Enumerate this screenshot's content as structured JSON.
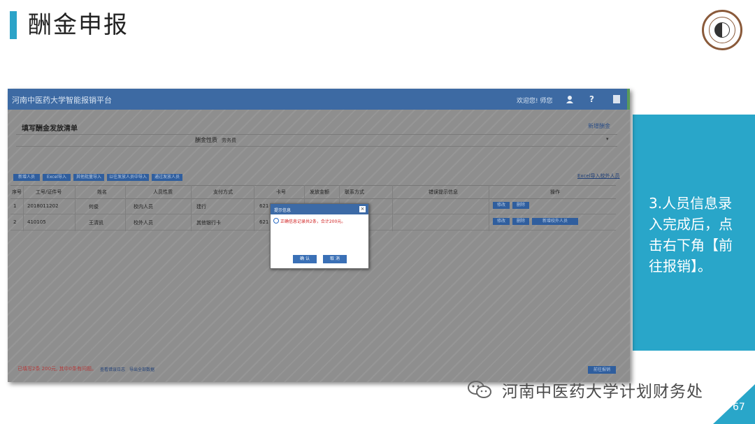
{
  "slide": {
    "title": "酬金申报",
    "side_instruction": "3.人员信息录入完成后，点击右下角【前往报销】。",
    "org_name": "河南中医药大学计划财务处",
    "page_number": "67",
    "accent_color": "#2ba3c8"
  },
  "app": {
    "title": "河南中医药大学智能报销平台",
    "welcome": "欢迎您! 师您",
    "icons": [
      "user-icon",
      "help-icon",
      "document-icon"
    ]
  },
  "form": {
    "title": "填写酬金发放清单",
    "new_link": "新增酬金",
    "property_label": "酬金性质",
    "property_value": "劳务费",
    "toolbar_buttons": [
      "新增人员",
      "Excel导入",
      "其他批量导入",
      "以往发放人员中导入",
      "通过发放人员"
    ],
    "import_link": "Excel导入校外人员",
    "columns": [
      "序号",
      "工号/证件号",
      "姓名",
      "人员性质",
      "支付方式",
      "卡号",
      "发放金额",
      "联系方式",
      "错误提示信息",
      "操作"
    ],
    "rows": [
      {
        "index": "1",
        "id": "2018011202",
        "name": "何俊",
        "type": "校内人员",
        "pay": "建行",
        "card": "621",
        "actions": [
          "修改",
          "删除"
        ]
      },
      {
        "index": "2",
        "id": "410105",
        "name": "王清凯",
        "type": "校外人员",
        "pay": "其他银行卡",
        "card": "621",
        "actions": [
          "修改",
          "删除",
          "新增校外人员"
        ]
      }
    ],
    "summary": "已填写2条 200元, 其中0条有问题。",
    "footer_link_1": "查看错误日志",
    "footer_link_2": "导出全部数据",
    "submit_button": "前往报销"
  },
  "dialog": {
    "title": "提示信息",
    "message": "正确信息记录共2条，合计200元。",
    "confirm": "确 认",
    "cancel": "取 消"
  }
}
